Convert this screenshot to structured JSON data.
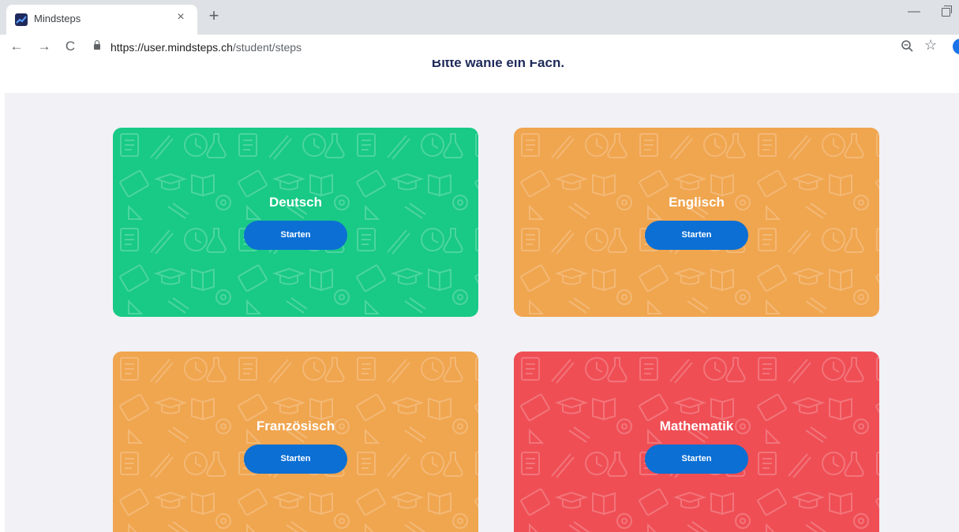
{
  "browser": {
    "tab_title": "Mindsteps",
    "tab_close": "×",
    "new_tab": "+",
    "minimize": "—",
    "url_host": "https://user.mindsteps.ch",
    "url_path": "/student/steps",
    "back": "←",
    "forward": "→",
    "reload": "C",
    "star": "☆"
  },
  "page": {
    "heading": "Bitte wähle ein Fach."
  },
  "subjects": [
    {
      "name": "Deutsch",
      "button": "Starten",
      "color": "#19c986"
    },
    {
      "name": "Englisch",
      "button": "Starten",
      "color": "#f0a54f"
    },
    {
      "name": "Französisch",
      "button": "Starten",
      "color": "#f0a54f"
    },
    {
      "name": "Mathematik",
      "button": "Starten",
      "color": "#ef4e55"
    }
  ],
  "colors": {
    "button": "#0b6fd4",
    "background": "#f1f1f6",
    "heading": "#1e2a5a"
  }
}
